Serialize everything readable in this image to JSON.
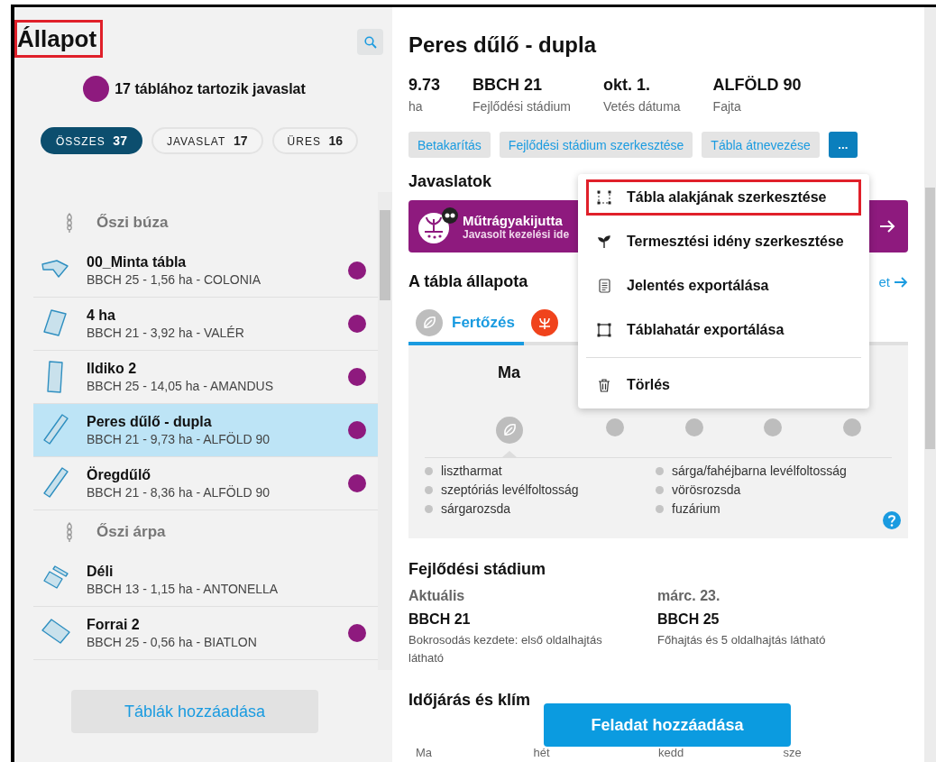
{
  "sidebar": {
    "title": "Állapot",
    "title_highlighted": true,
    "summary": "17 táblához tartozik javaslat",
    "filters": [
      {
        "label": "ÖSSZES",
        "count": "37",
        "selected": true
      },
      {
        "label": "JAVASLAT",
        "count": "17",
        "selected": false
      },
      {
        "label": "ÜRES",
        "count": "16",
        "selected": false
      }
    ],
    "groups": [
      {
        "crop": "Őszi búza",
        "fields": [
          {
            "name": "00_Minta tábla",
            "detail": "BBCH 25 - 1,56 ha - COLONIA",
            "suggestion": true,
            "selected": false
          },
          {
            "name": "4 ha",
            "detail": "BBCH 21 - 3,92 ha - VALÉR",
            "suggestion": true,
            "selected": false
          },
          {
            "name": "Ildiko 2",
            "detail": "BBCH 25 - 14,05 ha - AMANDUS",
            "suggestion": true,
            "selected": false
          },
          {
            "name": "Peres dűlő - dupla",
            "detail": "BBCH 21 - 9,73 ha - ALFÖLD 90",
            "suggestion": true,
            "selected": true
          },
          {
            "name": "Öregdűlő",
            "detail": "BBCH 21 - 8,36 ha - ALFÖLD 90",
            "suggestion": true,
            "selected": false
          }
        ]
      },
      {
        "crop": "Őszi árpa",
        "fields": [
          {
            "name": "Déli",
            "detail": "BBCH 13 - 1,15 ha - ANTONELLA",
            "suggestion": false,
            "selected": false
          },
          {
            "name": "Forrai 2",
            "detail": "BBCH 25 - 0,56 ha - BIATLON",
            "suggestion": true,
            "selected": false
          }
        ]
      }
    ],
    "add_button": "Táblák hozzáadása"
  },
  "detail": {
    "title": "Peres dűlő - dupla",
    "stats": [
      {
        "value": "9.73",
        "label": "ha"
      },
      {
        "value": "BBCH 21",
        "label": "Fejlődési stádium"
      },
      {
        "value": "okt. 1.",
        "label": "Vetés dátuma"
      },
      {
        "value": "ALFÖLD 90",
        "label": "Fajta"
      }
    ],
    "actions": [
      "Betakarítás",
      "Fejlődési stádium szerkesztése",
      "Tábla átnevezése"
    ],
    "more_button": "...",
    "suggestions_heading": "Javaslatok",
    "banner": {
      "title": "Műtrágyakijutta",
      "subtitle": "Javasolt kezelési ide"
    },
    "status_heading": "A tábla állapota",
    "status_link": "et",
    "tabs": [
      {
        "label": "Fertőzés",
        "selected": true,
        "kind": "infection"
      },
      {
        "selected": false,
        "kind": "plant"
      }
    ],
    "timeline": [
      {
        "label": "Ma",
        "kind": "current"
      },
      {
        "kind": "dot"
      },
      {
        "kind": "dot"
      },
      {
        "kind": "dot"
      },
      {
        "kind": "dot"
      }
    ],
    "legend": [
      "lisztharmat",
      "sárga/fahéjbarna levélfoltosság",
      "szeptóriás levélfoltosság",
      "vörösrozsda",
      "sárgarozsda",
      "fuzárium"
    ],
    "stage_heading": "Fejlődési stádium",
    "stages": [
      {
        "date": "Aktuális",
        "code": "BBCH 21",
        "description": "Bokrosodás kezdete: első oldalhajtás látható"
      },
      {
        "date": "márc. 23.",
        "code": "BBCH 25",
        "description": "Főhajtás és 5 oldalhajtás látható"
      }
    ],
    "weather_heading": "Időjárás és klím",
    "weather_days": [
      "Ma",
      "hét",
      "kedd",
      "sze"
    ],
    "task_button": "Feladat hozzáadása"
  },
  "menu": [
    {
      "label": "Tábla alakjának szerkesztése",
      "kind": "shape",
      "highlighted": true
    },
    {
      "label": "Termesztési idény szerkesztése",
      "kind": "season",
      "highlighted": false
    },
    {
      "label": "Jelentés exportálása",
      "kind": "report",
      "highlighted": false
    },
    {
      "label": "Táblahatár exportálása",
      "kind": "boundary",
      "highlighted": false
    },
    {
      "label": "Törlés",
      "kind": "delete",
      "highlighted": false
    }
  ]
}
